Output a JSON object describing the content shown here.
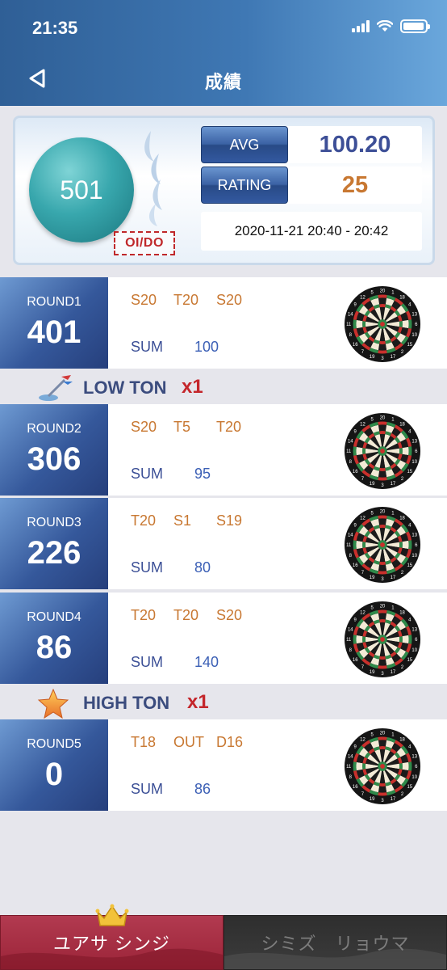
{
  "status": {
    "time": "21:35",
    "battery_level": 0.95
  },
  "header": {
    "title": "成績"
  },
  "summary": {
    "game": "501",
    "stamp": "OI/DO",
    "avg_label": "AVG",
    "avg_value": "100.20",
    "rating_label": "RATING",
    "rating_value": "25",
    "date_range": "2020-11-21 20:40 - 20:42"
  },
  "rounds": [
    {
      "name": "ROUND1",
      "score": "401",
      "throws": [
        "S20",
        "T20",
        "S20"
      ],
      "sum_label": "SUM",
      "sum": "100"
    },
    {
      "name": "ROUND2",
      "score": "306",
      "throws": [
        "S20",
        "T5",
        "T20"
      ],
      "sum_label": "SUM",
      "sum": "95"
    },
    {
      "name": "ROUND3",
      "score": "226",
      "throws": [
        "T20",
        "S1",
        "S19"
      ],
      "sum_label": "SUM",
      "sum": "80"
    },
    {
      "name": "ROUND4",
      "score": "86",
      "throws": [
        "T20",
        "T20",
        "S20"
      ],
      "sum_label": "SUM",
      "sum": "140"
    },
    {
      "name": "ROUND5",
      "score": "0",
      "throws": [
        "T18",
        "OUT",
        "D16"
      ],
      "sum_label": "SUM",
      "sum": "86"
    }
  ],
  "bonuses": [
    {
      "label": "LOW TON",
      "count": "x1",
      "icon": "dart-icon"
    },
    {
      "label": "HIGH TON",
      "count": "x1",
      "icon": "star-icon"
    }
  ],
  "tabs": [
    {
      "label": "ユアサ シンジ",
      "active": true
    },
    {
      "label": "シミズ　リョウマ",
      "active": false
    }
  ],
  "colors": {
    "header": "#3f78b4",
    "accent_orange": "#c87832",
    "accent_blue": "#3d4f97",
    "bonus_red": "#c4262b"
  }
}
